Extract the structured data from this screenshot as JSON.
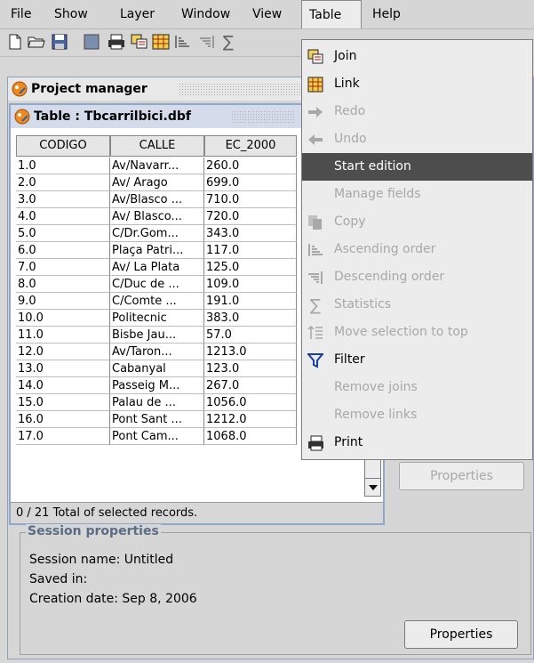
{
  "menubar": {
    "items": [
      {
        "label": "File"
      },
      {
        "label": "Show"
      },
      {
        "label": "Layer"
      },
      {
        "label": "Window"
      },
      {
        "label": "View"
      },
      {
        "label": "Table"
      },
      {
        "label": "Help"
      }
    ]
  },
  "project_manager": {
    "title": "Project manager"
  },
  "table_window": {
    "title": "Table : Tbcarrilbici.dbf",
    "columns": [
      "CODIGO",
      "CALLE",
      "EC_2000"
    ],
    "rows": [
      [
        "1.0",
        "Av/Navarr...",
        "260.0"
      ],
      [
        "2.0",
        "Av/ Arago",
        "699.0"
      ],
      [
        "3.0",
        "Av/Blasco ...",
        "710.0"
      ],
      [
        "4.0",
        "Av/ Blasco...",
        "720.0"
      ],
      [
        "5.0",
        "C/Dr.Gom...",
        "343.0"
      ],
      [
        "6.0",
        "Plaça Patri...",
        "117.0"
      ],
      [
        "7.0",
        "Av/ La Plata",
        "125.0"
      ],
      [
        "8.0",
        "C/Duc de ...",
        "109.0"
      ],
      [
        "9.0",
        "C/Comte ...",
        "191.0"
      ],
      [
        "10.0",
        "Politecnic",
        "383.0"
      ],
      [
        "11.0",
        "Bisbe Jau...",
        "57.0"
      ],
      [
        "12.0",
        "Av/Taron...",
        "1213.0"
      ],
      [
        "13.0",
        "Cabanyal",
        "123.0"
      ],
      [
        "14.0",
        "Passeig M...",
        "267.0"
      ],
      [
        "15.0",
        "Palau  de ...",
        "1056.0"
      ],
      [
        "16.0",
        "Pont Sant ...",
        "1212.0"
      ],
      [
        "17.0",
        "Pont Cam...",
        "1068.0"
      ]
    ],
    "status": "0 / 21 Total of selected records."
  },
  "properties_top": {
    "label": "Properties"
  },
  "session": {
    "title": "Session properties",
    "name_line": "Session name:  Untitled",
    "saved_line": "Saved in:",
    "date_line": "Creation date:  Sep 8, 2006",
    "button": "Properties"
  },
  "dropdown": {
    "items": [
      {
        "label": "Join",
        "icon": "join-icon",
        "state": "enabled"
      },
      {
        "label": "Link",
        "icon": "link-icon",
        "state": "enabled"
      },
      {
        "label": "Redo",
        "icon": "redo-arrow-icon",
        "state": "disabled"
      },
      {
        "label": "Undo",
        "icon": "undo-arrow-icon",
        "state": "disabled"
      },
      {
        "label": "Start edition",
        "icon": "",
        "state": "highlighted"
      },
      {
        "label": "Manage fields",
        "icon": "",
        "state": "disabled"
      },
      {
        "label": "Copy",
        "icon": "copy-icon",
        "state": "disabled"
      },
      {
        "label": "Ascending order",
        "icon": "ascending-order-icon",
        "state": "disabled"
      },
      {
        "label": "Descending order",
        "icon": "descending-order-icon",
        "state": "disabled"
      },
      {
        "label": "Statistics",
        "icon": "sigma-icon",
        "state": "disabled"
      },
      {
        "label": "Move selection to top",
        "icon": "move-selection-icon",
        "state": "disabled"
      },
      {
        "label": "Filter",
        "icon": "filter-icon",
        "state": "enabled"
      },
      {
        "label": "Remove joins",
        "icon": "",
        "state": "disabled"
      },
      {
        "label": "Remove links",
        "icon": "",
        "state": "disabled"
      },
      {
        "label": "Print",
        "icon": "printer-icon",
        "state": "enabled"
      }
    ]
  }
}
